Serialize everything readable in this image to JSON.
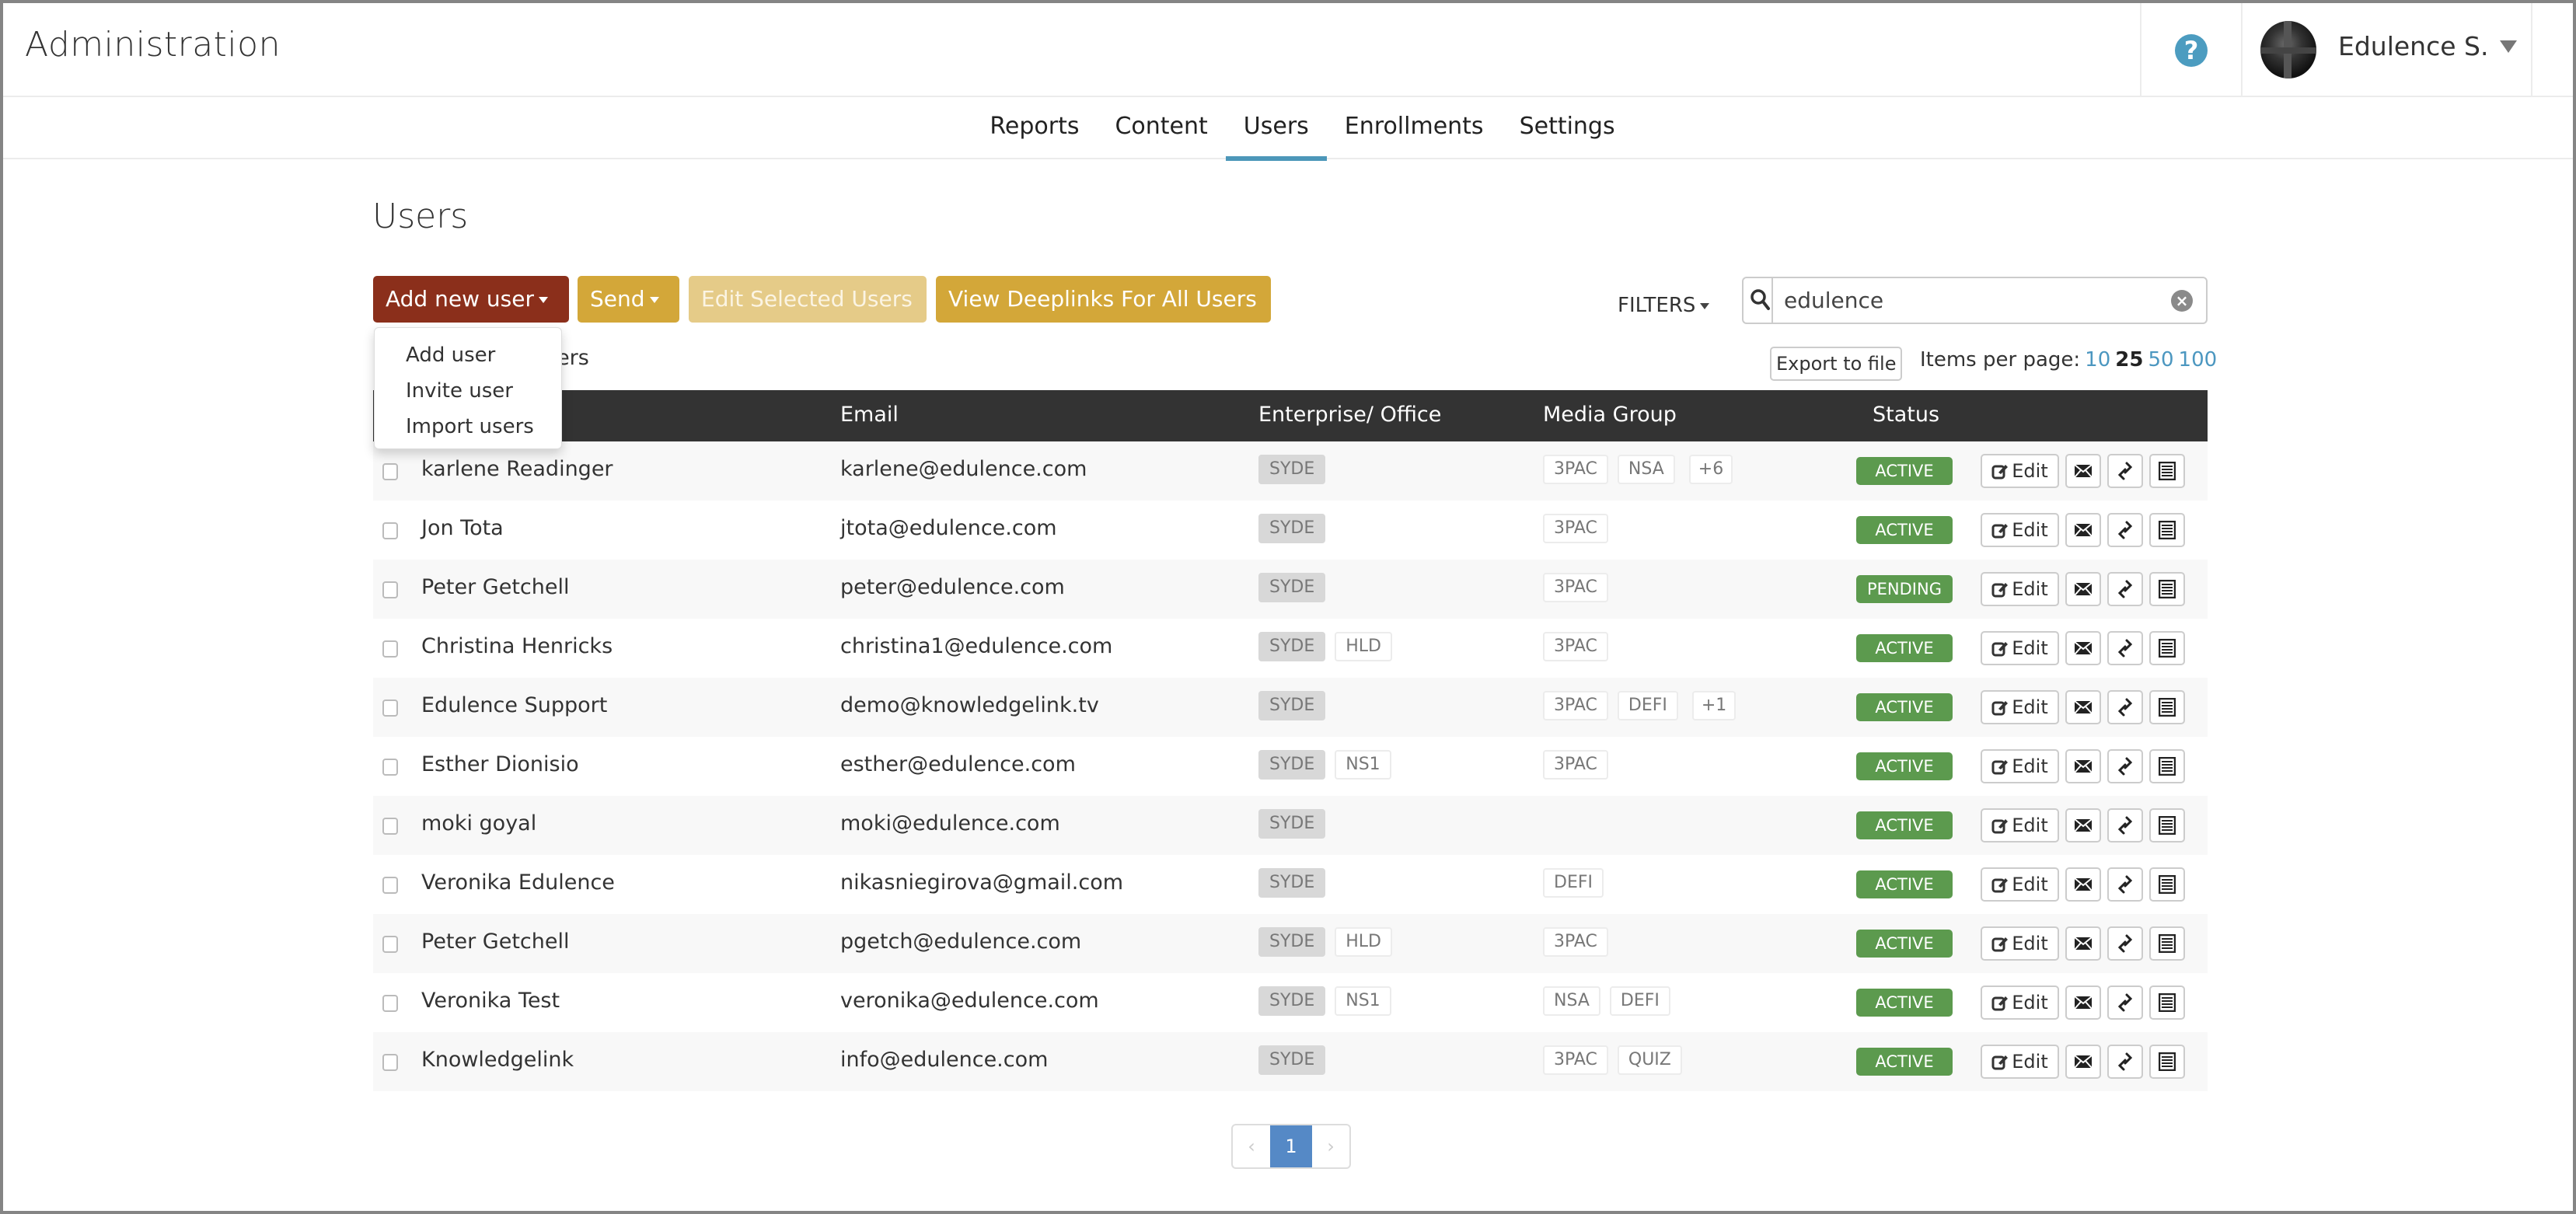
{
  "header": {
    "title": "Administration",
    "help_icon": "question-circle-icon",
    "user_name": "Edulence S."
  },
  "nav": {
    "tabs": [
      {
        "label": "Reports",
        "active": false
      },
      {
        "label": "Content",
        "active": false
      },
      {
        "label": "Users",
        "active": true
      },
      {
        "label": "Enrollments",
        "active": false
      },
      {
        "label": "Settings",
        "active": false
      }
    ]
  },
  "page": {
    "title": "Users",
    "count_text_left_fragment": "s",
    "count_text_right_fragment": "sers"
  },
  "toolbar": {
    "add_new_user_label": "Add new user",
    "send_label": "Send",
    "edit_selected_label": "Edit Selected Users",
    "view_deeplinks_label": "View Deeplinks For All Users",
    "add_menu": [
      "Add user",
      "Invite user",
      "Import users"
    ]
  },
  "filters": {
    "label": "FILTERS",
    "search_value": "edulence",
    "export_label": "Export to file",
    "items_per_page_label": "Items per page:",
    "items_per_page_options": [
      "10",
      "25",
      "50",
      "100"
    ],
    "items_per_page_selected": "25"
  },
  "table": {
    "columns": [
      "",
      "Email",
      "Enterprise/ Office",
      "Media Group",
      "Status"
    ],
    "edit_label": "Edit",
    "rows": [
      {
        "name": "karlene Readinger",
        "email": "karlene@edulence.com",
        "enterprise": [
          "SYDE"
        ],
        "media": [
          "3PAC",
          "NSA",
          "+6"
        ],
        "status": "ACTIVE"
      },
      {
        "name": "Jon Tota",
        "email": "jtota@edulence.com",
        "enterprise": [
          "SYDE"
        ],
        "media": [
          "3PAC"
        ],
        "status": "ACTIVE"
      },
      {
        "name": "Peter Getchell",
        "email": "peter@edulence.com",
        "enterprise": [
          "SYDE"
        ],
        "media": [
          "3PAC"
        ],
        "status": "PENDING"
      },
      {
        "name": "Christina Henricks",
        "email": "christina1@edulence.com",
        "enterprise": [
          "SYDE",
          "HLD"
        ],
        "media": [
          "3PAC"
        ],
        "status": "ACTIVE"
      },
      {
        "name": "Edulence Support",
        "email": "demo@knowledgelink.tv",
        "enterprise": [
          "SYDE"
        ],
        "media": [
          "3PAC",
          "DEFI",
          "+1"
        ],
        "status": "ACTIVE"
      },
      {
        "name": "Esther Dionisio",
        "email": "esther@edulence.com",
        "enterprise": [
          "SYDE",
          "NS1"
        ],
        "media": [
          "3PAC"
        ],
        "status": "ACTIVE"
      },
      {
        "name": "moki goyal",
        "email": "moki@edulence.com",
        "enterprise": [
          "SYDE"
        ],
        "media": [],
        "status": "ACTIVE"
      },
      {
        "name": "Veronika Edulence",
        "email": "nikasniegirova@gmail.com",
        "enterprise": [
          "SYDE"
        ],
        "media": [
          "DEFI"
        ],
        "status": "ACTIVE"
      },
      {
        "name": "Peter Getchell",
        "email": "pgetch@edulence.com",
        "enterprise": [
          "SYDE",
          "HLD"
        ],
        "media": [
          "3PAC"
        ],
        "status": "ACTIVE"
      },
      {
        "name": "Veronika Test",
        "email": "veronika@edulence.com",
        "enterprise": [
          "SYDE",
          "NS1"
        ],
        "media": [
          "NSA",
          "DEFI"
        ],
        "status": "ACTIVE"
      },
      {
        "name": "Knowledgelink",
        "email": "info@edulence.com",
        "enterprise": [
          "SYDE"
        ],
        "media": [
          "3PAC",
          "QUIZ"
        ],
        "status": "ACTIVE"
      }
    ]
  },
  "pagination": {
    "prev": "‹",
    "current": "1",
    "next": "›"
  },
  "colors": {
    "add_button": "#8b2f1b",
    "gold_button": "#d3a739",
    "gold_button_disabled": "#e5cb88",
    "table_header": "#333333",
    "status_active": "#5c9a4e",
    "tab_underline": "#4c97b9",
    "pagination_active": "#5589c6",
    "help_icon": "#4c9cc0"
  }
}
